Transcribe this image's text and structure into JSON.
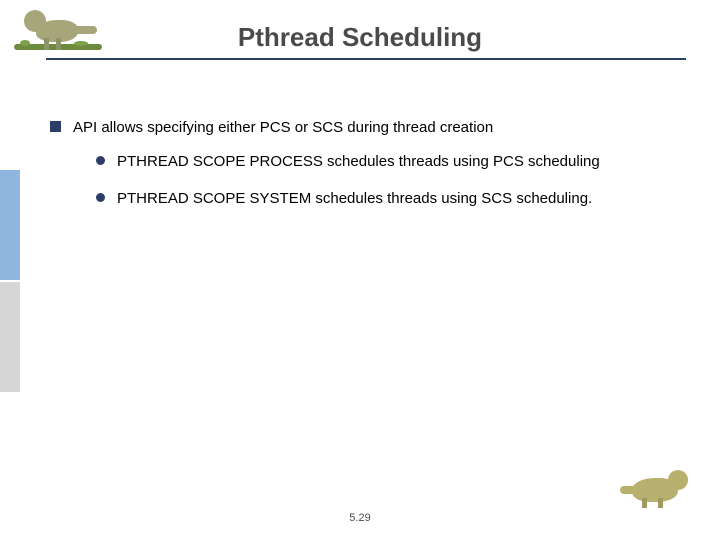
{
  "title": "Pthread Scheduling",
  "bullets": {
    "main": "API allows specifying either PCS or SCS during thread creation",
    "sub1": "PTHREAD SCOPE PROCESS schedules threads using PCS scheduling",
    "sub2": "PTHREAD SCOPE SYSTEM schedules threads using SCS scheduling."
  },
  "page_number": "5.29"
}
